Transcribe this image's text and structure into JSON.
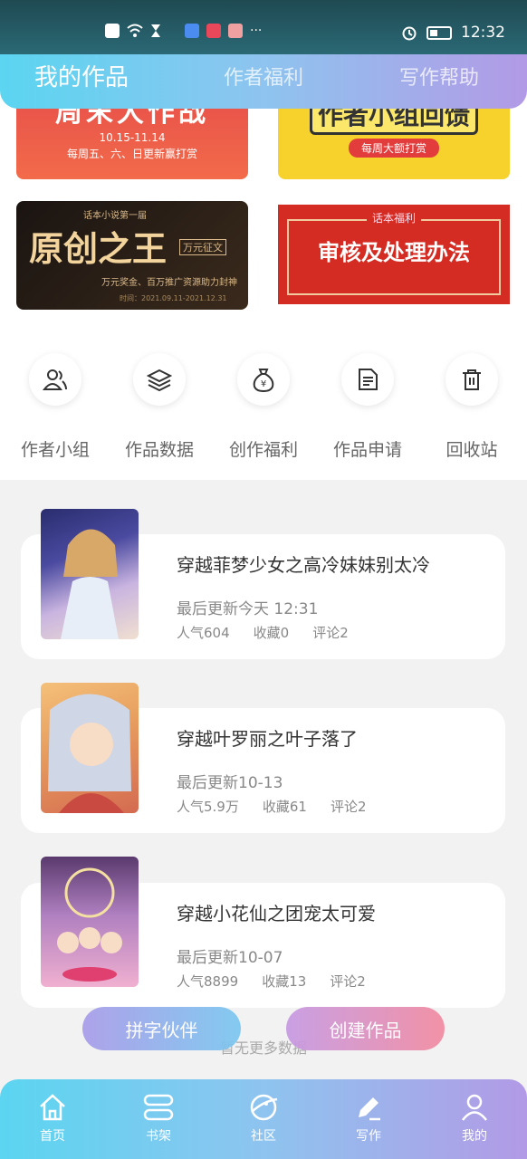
{
  "status_bar": {
    "time": "12:32",
    "dots": "···"
  },
  "top_tabs": [
    "我的作品",
    "作者福利",
    "写作帮助"
  ],
  "banners": {
    "weekend": {
      "title": "周末大作战",
      "dates": "10.15-11.14",
      "sub": "每周五、六、日更新赢打赏"
    },
    "group": {
      "title": "作者小组回馈",
      "sub": "每周大额打赏"
    },
    "original": {
      "top": "话本小说第一届",
      "title": "原创之王",
      "tag": "万元征文",
      "sub": "万元奖金、百万推广资源助力封神",
      "date": "时间：2021.09.11-2021.12.31"
    },
    "review": {
      "top": "话本福利",
      "title": "审核及处理办法"
    }
  },
  "features": [
    {
      "label": "作者小组",
      "icon": "people-icon"
    },
    {
      "label": "作品数据",
      "icon": "layers-icon"
    },
    {
      "label": "创作福利",
      "icon": "money-bag-icon"
    },
    {
      "label": "作品申请",
      "icon": "document-icon"
    },
    {
      "label": "回收站",
      "icon": "trash-icon"
    }
  ],
  "works": [
    {
      "title": "穿越菲梦少女之高冷妹妹别太冷",
      "update": "最后更新今天 12:31",
      "popularity": "人气604",
      "favorites": "收藏0",
      "comments": "评论2"
    },
    {
      "title": "穿越叶罗丽之叶子落了",
      "update": "最后更新10-13",
      "popularity": "人气5.9万",
      "favorites": "收藏61",
      "comments": "评论2"
    },
    {
      "title": "穿越小花仙之团宠太可爱",
      "update": "最后更新10-07",
      "popularity": "人气8899",
      "favorites": "收藏13",
      "comments": "评论2"
    }
  ],
  "no_more": "暂无更多数据",
  "fab": {
    "partner": "拼字伙伴",
    "create": "创建作品"
  },
  "bottom_nav": [
    {
      "label": "首页",
      "icon": "home-icon"
    },
    {
      "label": "书架",
      "icon": "bookshelf-icon"
    },
    {
      "label": "社区",
      "icon": "planet-icon"
    },
    {
      "label": "写作",
      "icon": "pen-icon"
    },
    {
      "label": "我的",
      "icon": "user-icon"
    }
  ],
  "colors": {
    "nav_start": "#5bd5f1",
    "nav_end": "#b29ae6"
  }
}
